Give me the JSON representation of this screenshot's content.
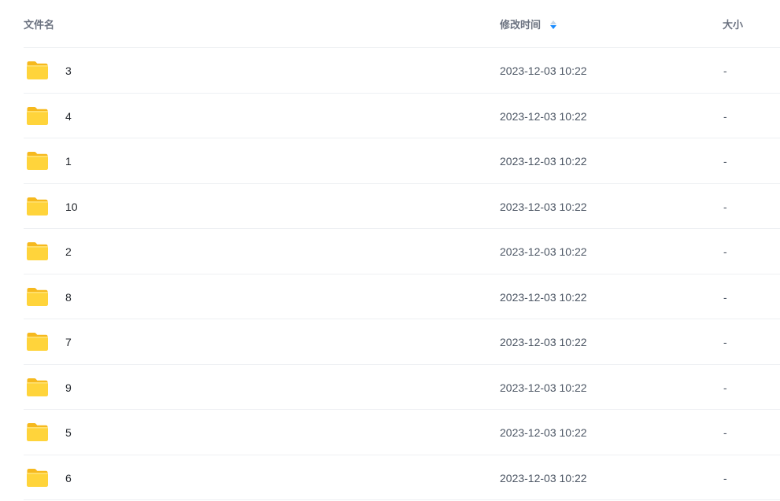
{
  "columns": {
    "name": "文件名",
    "modified": "修改时间",
    "size": "大小"
  },
  "sort": {
    "column": "modified",
    "direction": "descending",
    "icon": "sort-caret-icon"
  },
  "colors": {
    "folder_body": "#ffd43b",
    "folder_tab": "#f6b91e",
    "sort_active": "#1a8cff",
    "divider": "#eef0f3"
  },
  "files": [
    {
      "name": "3",
      "modified": "2023-12-03 10:22",
      "size": "-",
      "icon": "folder-icon"
    },
    {
      "name": "4",
      "modified": "2023-12-03 10:22",
      "size": "-",
      "icon": "folder-icon"
    },
    {
      "name": "1",
      "modified": "2023-12-03 10:22",
      "size": "-",
      "icon": "folder-icon"
    },
    {
      "name": "10",
      "modified": "2023-12-03 10:22",
      "size": "-",
      "icon": "folder-icon"
    },
    {
      "name": "2",
      "modified": "2023-12-03 10:22",
      "size": "-",
      "icon": "folder-icon"
    },
    {
      "name": "8",
      "modified": "2023-12-03 10:22",
      "size": "-",
      "icon": "folder-icon"
    },
    {
      "name": "7",
      "modified": "2023-12-03 10:22",
      "size": "-",
      "icon": "folder-icon"
    },
    {
      "name": "9",
      "modified": "2023-12-03 10:22",
      "size": "-",
      "icon": "folder-icon"
    },
    {
      "name": "5",
      "modified": "2023-12-03 10:22",
      "size": "-",
      "icon": "folder-icon"
    },
    {
      "name": "6",
      "modified": "2023-12-03 10:22",
      "size": "-",
      "icon": "folder-icon"
    }
  ]
}
